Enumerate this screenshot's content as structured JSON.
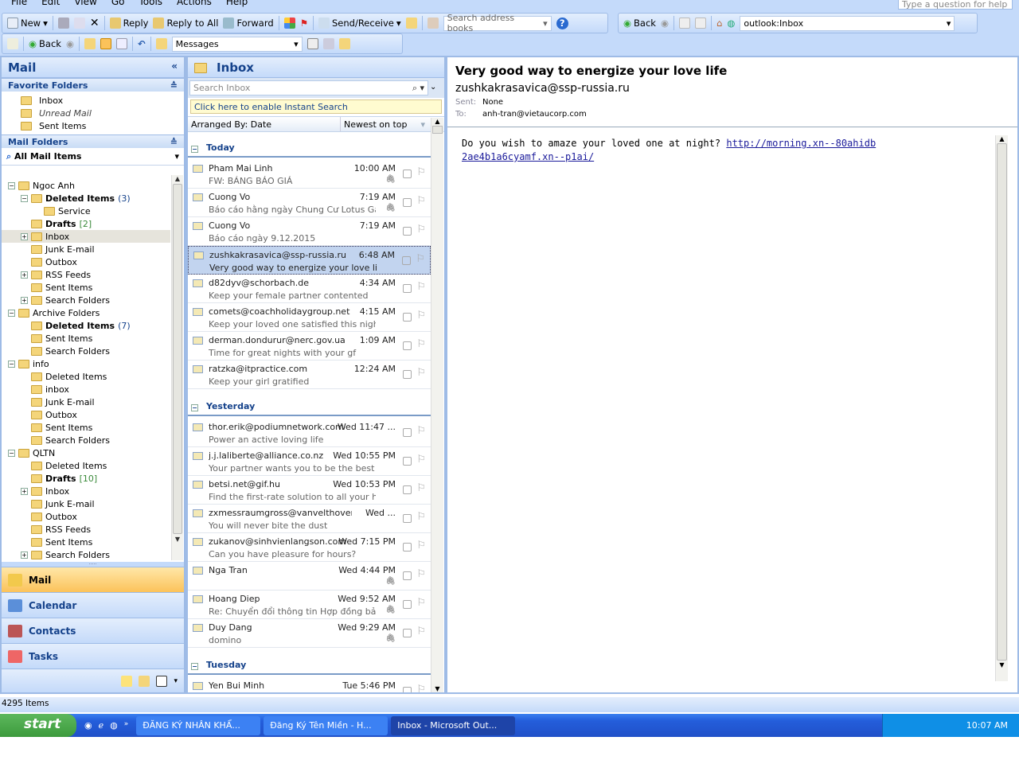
{
  "menu": [
    "File",
    "Edit",
    "View",
    "Go",
    "Tools",
    "Actions",
    "Help"
  ],
  "help_placeholder": "Type a question for help",
  "toolbar1": {
    "new": "New",
    "reply": "Reply",
    "reply_all": "Reply to All",
    "forward": "Forward",
    "send_receive": "Send/Receive",
    "search_address": "Search address books",
    "back": "Back",
    "address": "outlook:Inbox"
  },
  "toolbar2": {
    "back": "Back",
    "view": "Messages"
  },
  "nav": {
    "title": "Mail",
    "favorites_header": "Favorite Folders",
    "favorites": [
      {
        "label": "Inbox",
        "italic": false
      },
      {
        "label": "Unread Mail",
        "italic": true
      },
      {
        "label": "Sent Items",
        "italic": false
      }
    ],
    "mail_folders_header": "Mail Folders",
    "all_mail_items": "All Mail Items",
    "tree": [
      {
        "level": 0,
        "exp": "-",
        "label": "Ngoc Anh"
      },
      {
        "level": 1,
        "exp": "-",
        "label": "Deleted Items",
        "bold": true,
        "count": "(3)"
      },
      {
        "level": 2,
        "label": "Service"
      },
      {
        "level": 1,
        "label": "Drafts",
        "bold": true,
        "count": "[2]"
      },
      {
        "level": 1,
        "exp": "+",
        "label": "Inbox",
        "selected": true
      },
      {
        "level": 1,
        "label": "Junk E-mail"
      },
      {
        "level": 1,
        "label": "Outbox"
      },
      {
        "level": 1,
        "exp": "+",
        "label": "RSS Feeds"
      },
      {
        "level": 1,
        "label": "Sent Items"
      },
      {
        "level": 1,
        "exp": "+",
        "label": "Search Folders"
      },
      {
        "level": 0,
        "exp": "-",
        "label": "Archive Folders"
      },
      {
        "level": 1,
        "label": "Deleted Items",
        "bold": true,
        "count": "(7)"
      },
      {
        "level": 1,
        "label": "Sent Items"
      },
      {
        "level": 1,
        "label": "Search Folders"
      },
      {
        "level": 0,
        "exp": "-",
        "label": "info"
      },
      {
        "level": 1,
        "label": "Deleted Items"
      },
      {
        "level": 1,
        "label": "inbox"
      },
      {
        "level": 1,
        "label": "Junk E-mail"
      },
      {
        "level": 1,
        "label": "Outbox"
      },
      {
        "level": 1,
        "label": "Sent Items"
      },
      {
        "level": 1,
        "label": "Search Folders"
      },
      {
        "level": 0,
        "exp": "-",
        "label": "QLTN"
      },
      {
        "level": 1,
        "label": "Deleted Items"
      },
      {
        "level": 1,
        "label": "Drafts",
        "bold": true,
        "count": "[10]"
      },
      {
        "level": 1,
        "exp": "+",
        "label": "Inbox"
      },
      {
        "level": 1,
        "label": "Junk E-mail"
      },
      {
        "level": 1,
        "label": "Outbox"
      },
      {
        "level": 1,
        "label": "RSS Feeds"
      },
      {
        "level": 1,
        "label": "Sent Items"
      },
      {
        "level": 1,
        "exp": "+",
        "label": "Search Folders"
      }
    ],
    "buttons": [
      "Mail",
      "Calendar",
      "Contacts",
      "Tasks"
    ]
  },
  "list": {
    "title": "Inbox",
    "search_placeholder": "Search Inbox",
    "instant_search": "Click here to enable Instant Search",
    "arranged_by": "Arranged By: Date",
    "sort": "Newest on top",
    "groups": [
      {
        "label": "Today",
        "items": [
          {
            "from": "Pham Mai Linh",
            "time": "10:00 AM",
            "subject": "FW: BẢNG BÁO GIÁ",
            "attach": true
          },
          {
            "from": "Cuong Vo",
            "time": "7:19 AM",
            "subject": "Báo cáo hằng ngày Chung Cư Lotus Gar...",
            "attach": true
          },
          {
            "from": "Cuong Vo",
            "time": "7:19 AM",
            "subject": "Báo cáo ngày 9.12.2015"
          },
          {
            "from": "zushkakrasavica@ssp-russia.ru",
            "time": "6:48 AM",
            "subject": "Very good way to energize your love life",
            "selected": true
          },
          {
            "from": "d82dyv@schorbach.de",
            "time": "4:34 AM",
            "subject": "Keep your female partner contented"
          },
          {
            "from": "comets@coachholidaygroup.net",
            "time": "4:15 AM",
            "subject": "Keep your loved one satisfied this night"
          },
          {
            "from": "derman.dondurur@nerc.gov.ua",
            "time": "1:09 AM",
            "subject": "Time for great nights with your gf"
          },
          {
            "from": "ratzka@itpractice.com",
            "time": "12:24 AM",
            "subject": "Keep your girl gratified"
          }
        ]
      },
      {
        "label": "Yesterday",
        "items": [
          {
            "from": "thor.erik@podiumnetwork.com",
            "time": "Wed 11:47 ...",
            "subject": "Power an active loving life"
          },
          {
            "from": "j.j.laliberte@alliance.co.nz",
            "time": "Wed 10:55 PM",
            "subject": "Your partner wants you to be the best"
          },
          {
            "from": "betsi.net@gif.hu",
            "time": "Wed 10:53 PM",
            "subject": "Find the first-rate solution to all your healt..."
          },
          {
            "from": "zxmessraumgross@vanvelthoven.com",
            "time": "Wed ...",
            "subject": "You will never bite the dust"
          },
          {
            "from": "zukanov@sinhvienlangson.com",
            "time": "Wed 7:15 PM",
            "subject": "Can you have pleasure for hours?"
          },
          {
            "from": "Nga Tran",
            "time": "Wed 4:44 PM",
            "subject": "",
            "attach": true
          },
          {
            "from": "Hoang Diep",
            "time": "Wed 9:52 AM",
            "subject": "Re: Chuyển đổi thông tin Hợp đồng bảo ...",
            "attach": true
          },
          {
            "from": "Duy Dang",
            "time": "Wed 9:29 AM",
            "subject": "domino",
            "attach": true
          }
        ]
      },
      {
        "label": "Tuesday",
        "items": [
          {
            "from": "Yen Bui Minh",
            "time": "Tue 5:46 PM",
            "subject": ""
          }
        ]
      }
    ]
  },
  "reading": {
    "subject": "Very good way to energize your love life",
    "from": "zushkakrasavica@ssp-russia.ru",
    "sent_label": "Sent:",
    "sent": "None",
    "to_label": "To:",
    "to": "anh-tran@vietaucorp.com",
    "body": "Do you wish to amaze your loved one at night? ",
    "link": "http://morning.xn--80ahidb2ae4b1a6cyamf.xn--p1ai/"
  },
  "status": {
    "items": "4295 Items"
  },
  "taskbar": {
    "start": "start",
    "tasks": [
      "ĐĂNG KÝ NHÂN KHẨ...",
      "Đăng Ký Tên Miền - H...",
      "Inbox - Microsoft Out..."
    ],
    "clock": "10:07 AM"
  },
  "colors": {
    "accent": "#15428b",
    "selected_nav": "#fbc25a",
    "taskbar": "#245edb",
    "start": "#3c9a3c"
  }
}
